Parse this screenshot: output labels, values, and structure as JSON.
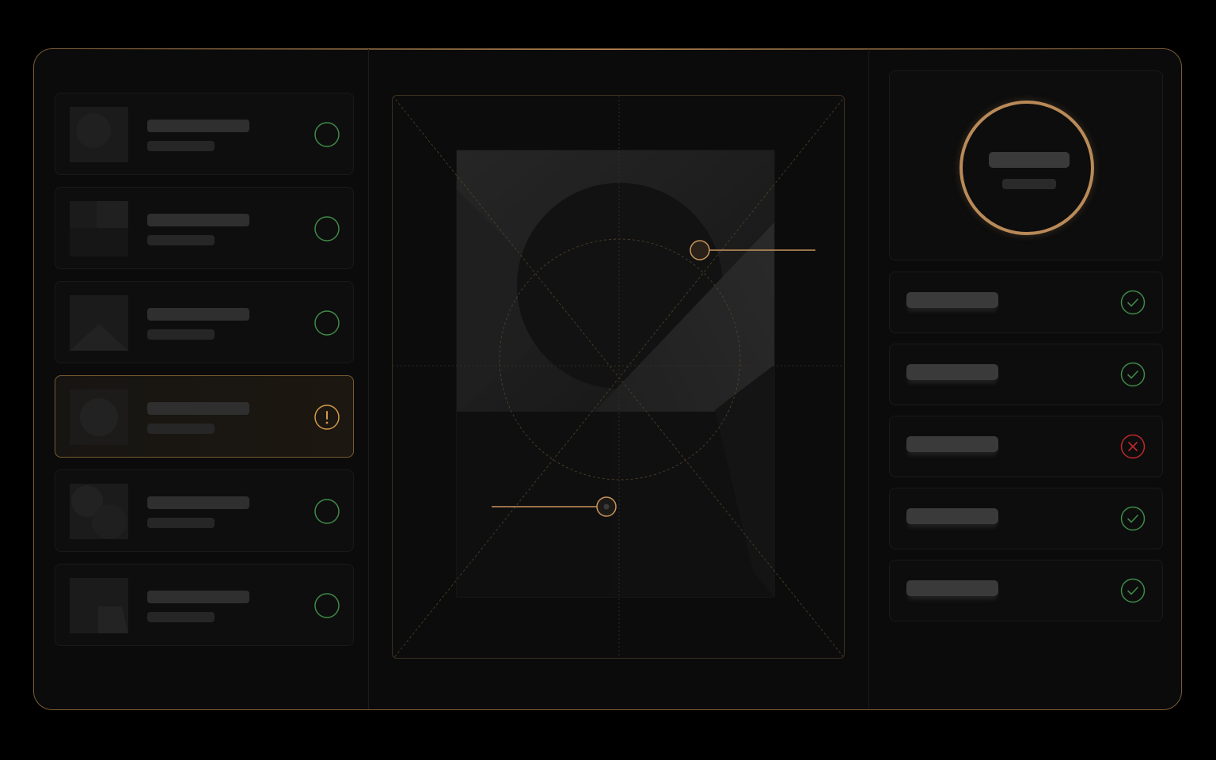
{
  "colors": {
    "accent": "#c9945c",
    "ok": "#3f8a48",
    "error": "#c0282c",
    "warning": "#d29a4c",
    "surface": "#0b0b0b"
  },
  "asset_list": {
    "items": [
      {
        "title": "",
        "subtitle": "",
        "status": "ok",
        "status_icon": "circle-ok-icon",
        "selected": false
      },
      {
        "title": "",
        "subtitle": "",
        "status": "ok",
        "status_icon": "circle-ok-icon",
        "selected": false
      },
      {
        "title": "",
        "subtitle": "",
        "status": "ok",
        "status_icon": "circle-ok-icon",
        "selected": false
      },
      {
        "title": "",
        "subtitle": "",
        "status": "warning",
        "status_icon": "exclamation-icon",
        "selected": true
      },
      {
        "title": "",
        "subtitle": "",
        "status": "ok",
        "status_icon": "circle-ok-icon",
        "selected": false
      },
      {
        "title": "",
        "subtitle": "",
        "status": "ok",
        "status_icon": "circle-ok-icon",
        "selected": false
      }
    ]
  },
  "canvas": {
    "handles": [
      "handle-top-right",
      "handle-bottom-left"
    ]
  },
  "profile": {
    "name": "",
    "subtitle": ""
  },
  "checklist": {
    "rows": [
      {
        "label": "",
        "status": "pass",
        "icon": "check-icon"
      },
      {
        "label": "",
        "status": "pass",
        "icon": "check-icon"
      },
      {
        "label": "",
        "status": "fail",
        "icon": "x-icon"
      },
      {
        "label": "",
        "status": "pass",
        "icon": "check-icon"
      },
      {
        "label": "",
        "status": "pass",
        "icon": "check-icon"
      }
    ]
  }
}
